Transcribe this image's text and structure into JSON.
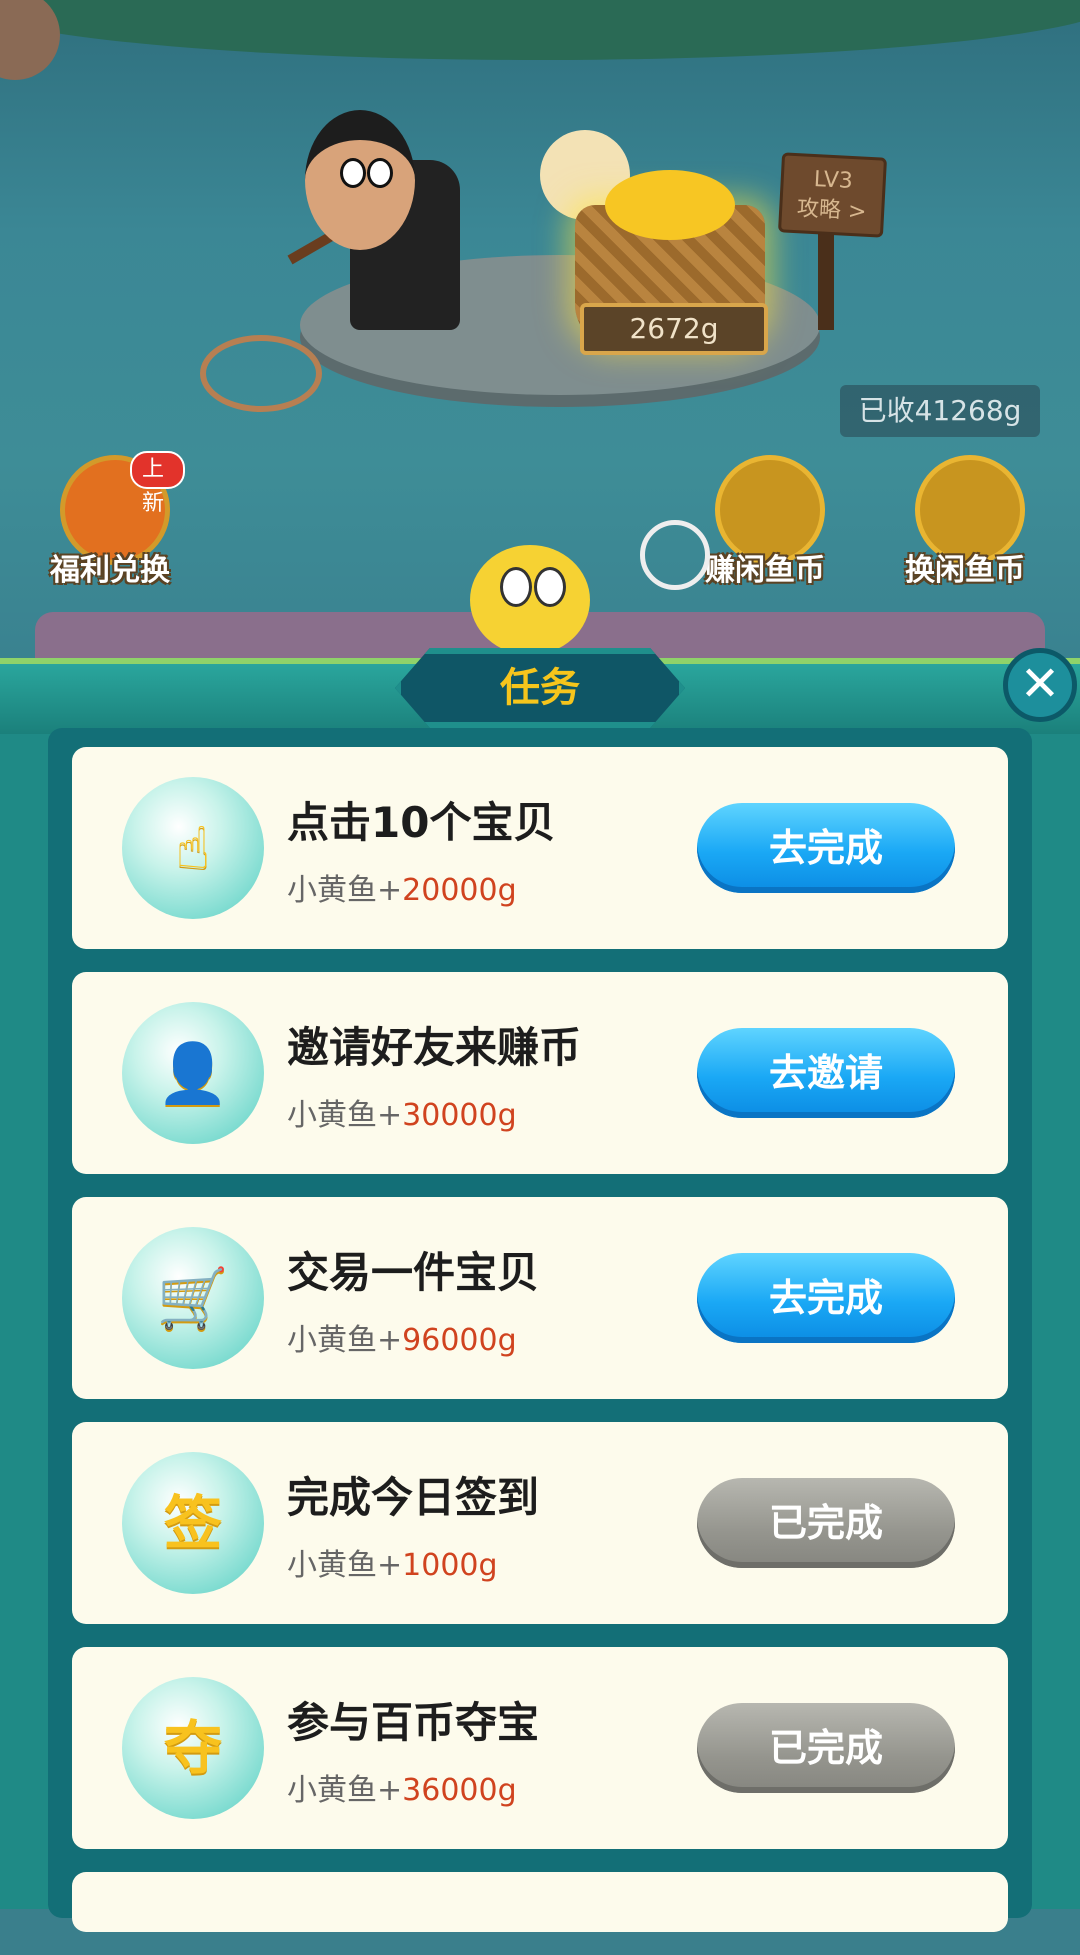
{
  "scene": {
    "basket_weight": "2672g",
    "level_sign": [
      "LV3",
      "攻略 >"
    ],
    "collected": "已收41268g"
  },
  "side_buttons": {
    "welfare": {
      "label": "福利兑换",
      "badge": "上新"
    },
    "earn": {
      "label": "赚闲鱼币"
    },
    "exchange": {
      "label": "换闲鱼币"
    }
  },
  "panel": {
    "title": "任务",
    "close_icon": "close-icon"
  },
  "tasks": [
    {
      "icon": "hand-tap-icon",
      "icon_glyph": "☝",
      "title": "点击10个宝贝",
      "reward_prefix": "小黄鱼+",
      "reward_amount": "20000g",
      "button": "去完成",
      "state": "active"
    },
    {
      "icon": "add-friend-icon",
      "icon_glyph": "👤",
      "title": "邀请好友来赚币",
      "reward_prefix": "小黄鱼+",
      "reward_amount": "30000g",
      "button": "去邀请",
      "state": "active"
    },
    {
      "icon": "cart-icon",
      "icon_glyph": "🛒",
      "title": "交易一件宝贝",
      "reward_prefix": "小黄鱼+",
      "reward_amount": "96000g",
      "button": "去完成",
      "state": "active"
    },
    {
      "icon": "sign-in-icon",
      "icon_glyph": "签",
      "title": "完成今日签到",
      "reward_prefix": "小黄鱼+",
      "reward_amount": "1000g",
      "button": "已完成",
      "state": "done"
    },
    {
      "icon": "treasure-icon",
      "icon_glyph": "夺",
      "title": "参与百币夺宝",
      "reward_prefix": "小黄鱼+",
      "reward_amount": "36000g",
      "button": "已完成",
      "state": "done"
    }
  ],
  "colors": {
    "reward_amount": "#d0431f",
    "active_button": "#1aa8f5",
    "done_button": "#95958e",
    "title_gold": "#f6c51c"
  }
}
